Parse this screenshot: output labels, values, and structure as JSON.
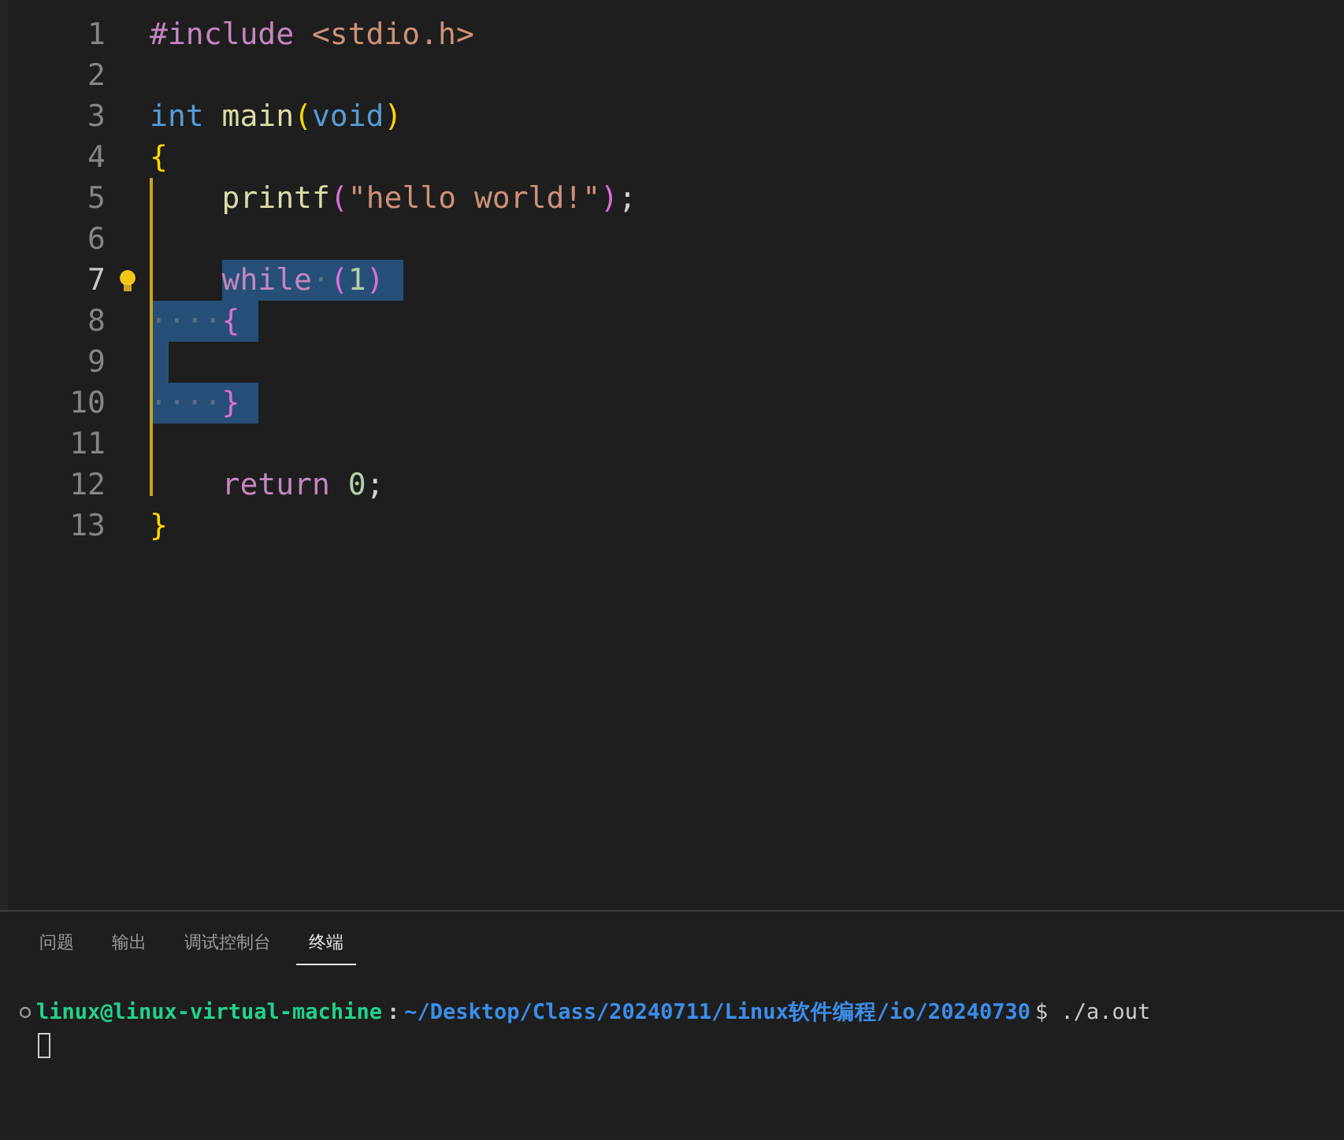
{
  "editor": {
    "lines": [
      {
        "number": "1",
        "current": false,
        "lightbulb": false,
        "indented": false,
        "trailing_selection": false,
        "tokens": [
          {
            "text": "#include",
            "kind": "keyword",
            "selected": false,
            "space_after": true
          },
          {
            "text": "<stdio.h>",
            "kind": "string",
            "selected": false
          }
        ]
      },
      {
        "number": "2",
        "current": false,
        "lightbulb": false,
        "indented": false,
        "trailing_selection": false
      },
      {
        "number": "3",
        "current": false,
        "lightbulb": false,
        "indented": false,
        "trailing_selection": false,
        "tokens": [
          {
            "text": "int",
            "kind": "type",
            "selected": false,
            "space_after": true
          },
          {
            "text": "main",
            "kind": "function",
            "selected": false
          },
          {
            "text": "(",
            "kind": "bracket1",
            "selected": false
          },
          {
            "text": "void",
            "kind": "type",
            "selected": false
          },
          {
            "text": ")",
            "kind": "bracket1",
            "selected": false
          }
        ]
      },
      {
        "number": "4",
        "current": false,
        "lightbulb": false,
        "indented": false,
        "trailing_selection": false,
        "tokens": [
          {
            "text": "{",
            "kind": "bracket1",
            "selected": false
          }
        ]
      },
      {
        "number": "5",
        "current": false,
        "lightbulb": false,
        "indented": true,
        "trailing_selection": false,
        "tokens": [
          {
            "text": "printf",
            "kind": "function",
            "selected": false
          },
          {
            "text": "(",
            "kind": "bracket2",
            "selected": false
          },
          {
            "text": "\"hello world!\"",
            "kind": "string",
            "selected": false
          },
          {
            "text": ")",
            "kind": "bracket2",
            "selected": false
          },
          {
            "text": ";",
            "kind": "plain",
            "selected": false
          }
        ]
      },
      {
        "number": "6",
        "current": false,
        "lightbulb": false,
        "indented": false,
        "trailing_selection": false
      },
      {
        "number": "7",
        "current": true,
        "lightbulb": true,
        "indented": true,
        "trailing_selection": true,
        "tokens": [
          {
            "text": "while",
            "kind": "keyword",
            "selected": true
          },
          {
            "text": "·",
            "kind": "whitespace",
            "selected": true
          },
          {
            "text": "(",
            "kind": "bracket2",
            "selected": true
          },
          {
            "text": "1",
            "kind": "number",
            "selected": true
          },
          {
            "text": ")",
            "kind": "bracket2",
            "selected": true
          }
        ]
      },
      {
        "number": "8",
        "current": false,
        "lightbulb": false,
        "indented": false,
        "trailing_selection": true,
        "tokens": [
          {
            "text": "····",
            "kind": "whitespace",
            "selected": true
          },
          {
            "text": "{",
            "kind": "bracket2",
            "selected": true
          }
        ]
      },
      {
        "number": "9",
        "current": false,
        "lightbulb": false,
        "indented": false,
        "trailing_selection": true
      },
      {
        "number": "10",
        "current": false,
        "lightbulb": false,
        "indented": false,
        "trailing_selection": true,
        "tokens": [
          {
            "text": "····",
            "kind": "whitespace",
            "selected": true
          },
          {
            "text": "}",
            "kind": "bracket2",
            "selected": true
          }
        ]
      },
      {
        "number": "11",
        "current": false,
        "lightbulb": false,
        "indented": false,
        "trailing_selection": false
      },
      {
        "number": "12",
        "current": false,
        "lightbulb": false,
        "indented": true,
        "trailing_selection": false,
        "tokens": [
          {
            "text": "return",
            "kind": "keyword",
            "selected": false,
            "space_after": true
          },
          {
            "text": "0",
            "kind": "number",
            "selected": false
          },
          {
            "text": ";",
            "kind": "plain",
            "selected": false
          }
        ]
      },
      {
        "number": "13",
        "current": false,
        "lightbulb": false,
        "indented": false,
        "trailing_selection": false,
        "tokens": [
          {
            "text": "}",
            "kind": "bracket1",
            "selected": false
          }
        ]
      }
    ]
  },
  "panel": {
    "tabs": [
      {
        "label": "问题",
        "selected": false
      },
      {
        "label": "输出",
        "selected": false
      },
      {
        "label": "调试控制台",
        "selected": false
      },
      {
        "label": "终端",
        "selected": true
      }
    ],
    "terminal": {
      "user": "linux@linux-virtual-machine",
      "separator": ":",
      "path": "~/Desktop/Class/20240711/Linux软件编程/io/20240730",
      "command": "$ ./a.out"
    }
  }
}
